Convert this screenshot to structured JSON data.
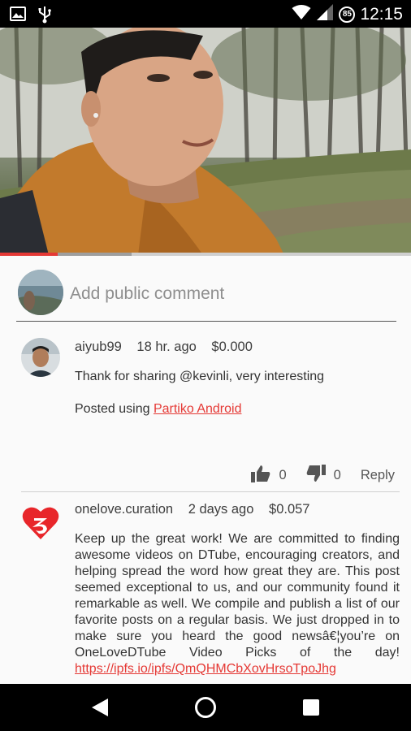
{
  "status_bar": {
    "time": "12:15",
    "battery_level": "85",
    "icons": [
      "image-icon",
      "usb-icon",
      "wifi-icon",
      "signal-icon"
    ]
  },
  "video": {
    "progress_percent": 14,
    "buffered_percent": 32
  },
  "composer": {
    "placeholder": "Add public comment"
  },
  "comments": [
    {
      "author": "aiyub99",
      "time": "18 hr. ago",
      "payout": "$0.000",
      "body_line1": "Thank for sharing @kevinli, very interesting",
      "posted_prefix": "Posted using ",
      "posted_link": "Partiko Android",
      "likes": "0",
      "dislikes": "0",
      "reply_label": "Reply"
    },
    {
      "author": "onelove.curation",
      "time": "2 days ago",
      "payout": "$0.057",
      "body": "Keep up the great work! We are committed to finding awesome videos on DTube, encouraging creators, and helping spread the word how great they are. This post seemed exceptional to us, and our community found it remarkable as well. We compile and publish a list of our favorite posts on a regular basis. We just dropped in to make sure you heard the good newsâ€¦you’re on OneLoveDTube Video Picks of the day!",
      "link": "https://ipfs.io/ipfs/QmQHMCbXovHrsoTpoJhg"
    }
  ],
  "colors": {
    "accent": "#e53935",
    "status_bar": "#000000",
    "background": "#fafafa"
  }
}
